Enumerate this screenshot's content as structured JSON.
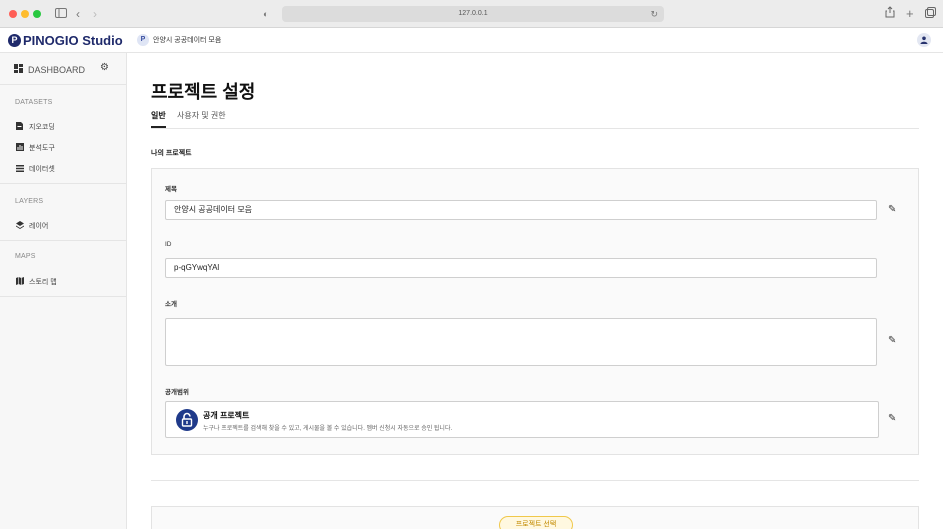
{
  "browser": {
    "url": "127.0.0.1"
  },
  "header": {
    "logo_text": "PINOGIO Studio",
    "logo_mark": "P",
    "project_badge": "P",
    "project_name": "안양시 공공데이터 모음"
  },
  "sidebar": {
    "dashboard_label": "DASHBOARD",
    "sections": [
      {
        "title": "DATASETS",
        "items": [
          {
            "label": "지오코딩",
            "icon": "document-icon"
          },
          {
            "label": "분석도구",
            "icon": "chart-icon"
          },
          {
            "label": "데이터셋",
            "icon": "list-icon"
          }
        ]
      },
      {
        "title": "LAYERS",
        "items": [
          {
            "label": "레이어",
            "icon": "layers-icon"
          }
        ]
      },
      {
        "title": "MAPS",
        "items": [
          {
            "label": "스토리 맵",
            "icon": "map-icon"
          }
        ]
      }
    ]
  },
  "main": {
    "page_title": "프로젝트 설정",
    "tabs": [
      {
        "label": "일반",
        "active": true
      },
      {
        "label": "사용자 및 권한",
        "active": false
      }
    ],
    "section_title": "나의 프로젝트",
    "fields": {
      "title_label": "제목",
      "title_value": "안양시 공공데이터 모음",
      "id_label": "ID",
      "id_value": "p-qGYwqYAl",
      "intro_label": "소개",
      "intro_value": "",
      "visibility_label": "공개범위",
      "visibility_title": "공개 프로젝트",
      "visibility_desc": "누구나 프로젝트를 검색해 찾을 수 있고, 게시물을 볼 수 있습니다. 멤버 신청시 자동으로 승인 됩니다."
    },
    "select_button": "프로젝트 선택"
  },
  "colors": {
    "brand": "#1f2a6b",
    "lock_icon_bg": "#1f3a8a",
    "accent_yellow": "#f0c84a"
  }
}
